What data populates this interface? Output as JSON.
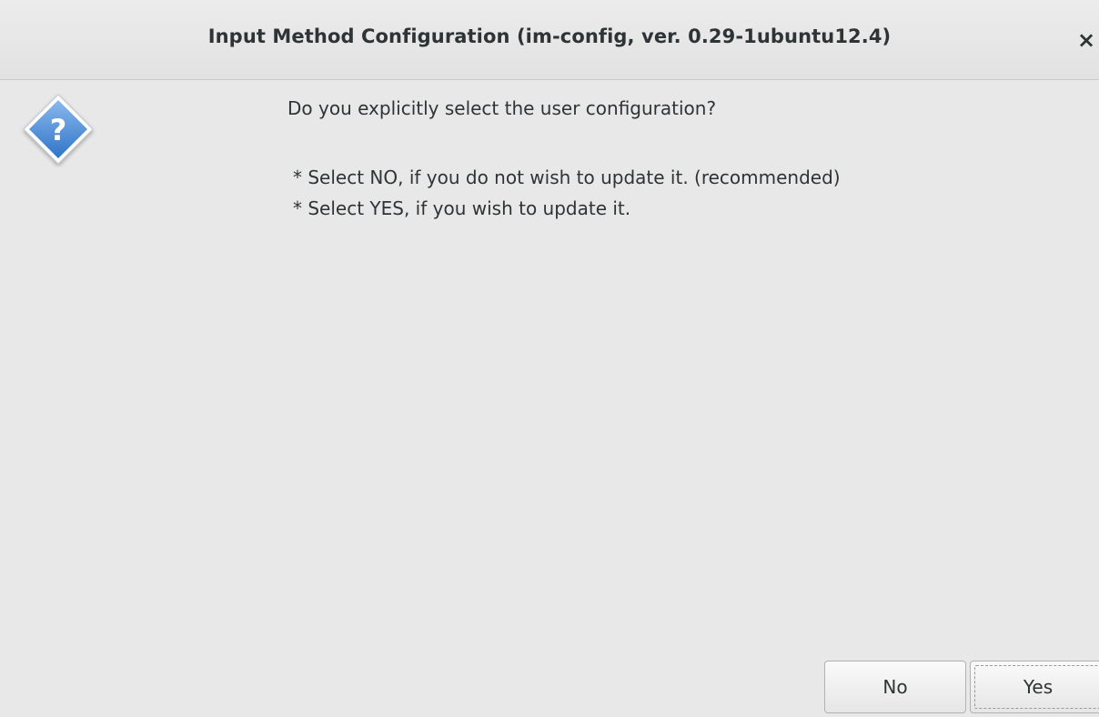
{
  "window": {
    "title": "Input Method Configuration (im-config, ver. 0.29-1ubuntu12.4)",
    "close_label": "×"
  },
  "dialog": {
    "icon": "question-icon",
    "message": "Do you explicitly select the user configuration?",
    "bullets": [
      "* Select NO, if you do not wish to update it. (recommended)",
      "* Select YES, if you wish to update it."
    ]
  },
  "buttons": {
    "no_label": "No",
    "yes_label": "Yes"
  },
  "colors": {
    "background": "#e8e8e8",
    "text": "#2e3436",
    "icon_fill": "#4a90d9",
    "icon_border": "#ffffff"
  }
}
